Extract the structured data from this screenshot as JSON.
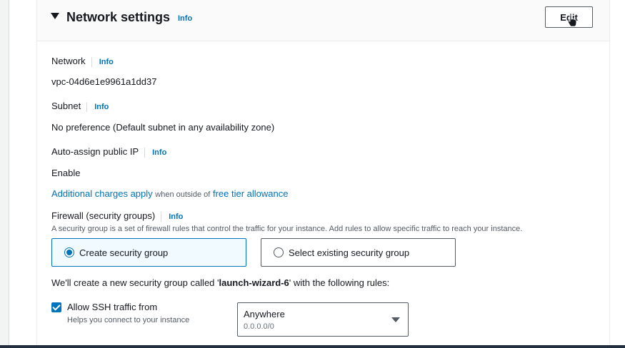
{
  "section": {
    "title": "Network settings",
    "info": "Info",
    "edit_label": "Edit"
  },
  "fields": {
    "network": {
      "label": "Network",
      "info": "Info",
      "value": "vpc-04d6e1e9961a1dd37"
    },
    "subnet": {
      "label": "Subnet",
      "info": "Info",
      "value": "No preference (Default subnet in any availability zone)"
    },
    "public_ip": {
      "label": "Auto-assign public IP",
      "info": "Info",
      "value": "Enable"
    }
  },
  "charges": {
    "link1": "Additional charges apply",
    "middle": "when outside of",
    "link2": "free tier allowance"
  },
  "firewall": {
    "label": "Firewall (security groups)",
    "info": "Info",
    "description": "A security group is a set of firewall rules that control the traffic for your instance. Add rules to allow specific traffic to reach your instance.",
    "options": [
      {
        "label": "Create security group",
        "selected": true
      },
      {
        "label": "Select existing security group",
        "selected": false
      }
    ],
    "rules_prefix": "We'll create a new security group called '",
    "group_name": "launch-wizard-6",
    "rules_suffix": "' with the following rules:"
  },
  "ssh_rule": {
    "label": "Allow SSH traffic from",
    "checked": true,
    "hint": "Helps you connect to your instance",
    "source_value": "Anywhere",
    "source_cidr": "0.0.0.0/0"
  },
  "colors": {
    "link": "#0073bb",
    "text": "#16191f",
    "muted": "#545b64",
    "selected_bg": "#f1faff"
  },
  "icons": {
    "caret": "caret-down-icon",
    "cursor": "hand-pointer-icon",
    "dropdown": "chevron-down-icon"
  }
}
